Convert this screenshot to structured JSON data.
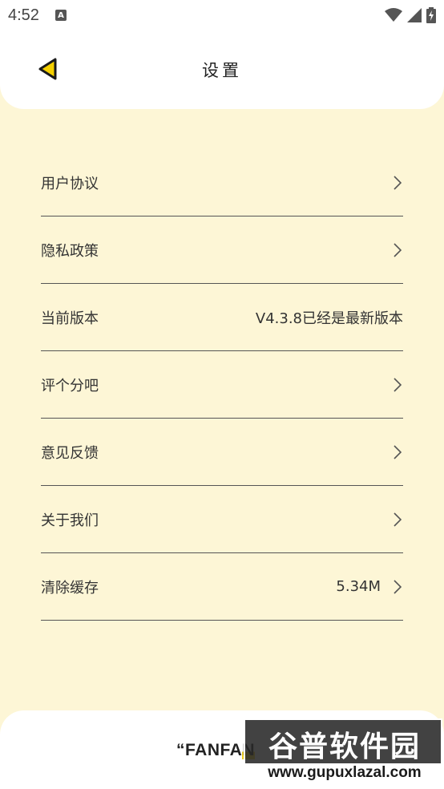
{
  "status_bar": {
    "time": "4:52",
    "notification_letter": "A"
  },
  "header": {
    "title": "设置",
    "back_icon": "triangle-back-icon",
    "accent_color": "#f5d000"
  },
  "settings": {
    "items": [
      {
        "label": "用户协议",
        "value": "",
        "has_chevron": true
      },
      {
        "label": "隐私政策",
        "value": "",
        "has_chevron": true
      },
      {
        "label": "当前版本",
        "value": "V4.3.8已经是最新版本",
        "has_chevron": false
      },
      {
        "label": "评个分吧",
        "value": "",
        "has_chevron": true
      },
      {
        "label": "意见反馈",
        "value": "",
        "has_chevron": true
      },
      {
        "label": "关于我们",
        "value": "",
        "has_chevron": true
      },
      {
        "label": "清除缓存",
        "value": "5.34M",
        "has_chevron": true
      }
    ]
  },
  "footer": {
    "brand_prefix": "“FANFA",
    "brand_highlight": "N"
  },
  "watermark": {
    "title": "谷普软件园",
    "url": "www.gupuxlazal.com"
  },
  "colors": {
    "background": "#fdf6d6",
    "card": "#ffffff",
    "divider": "#555555"
  }
}
